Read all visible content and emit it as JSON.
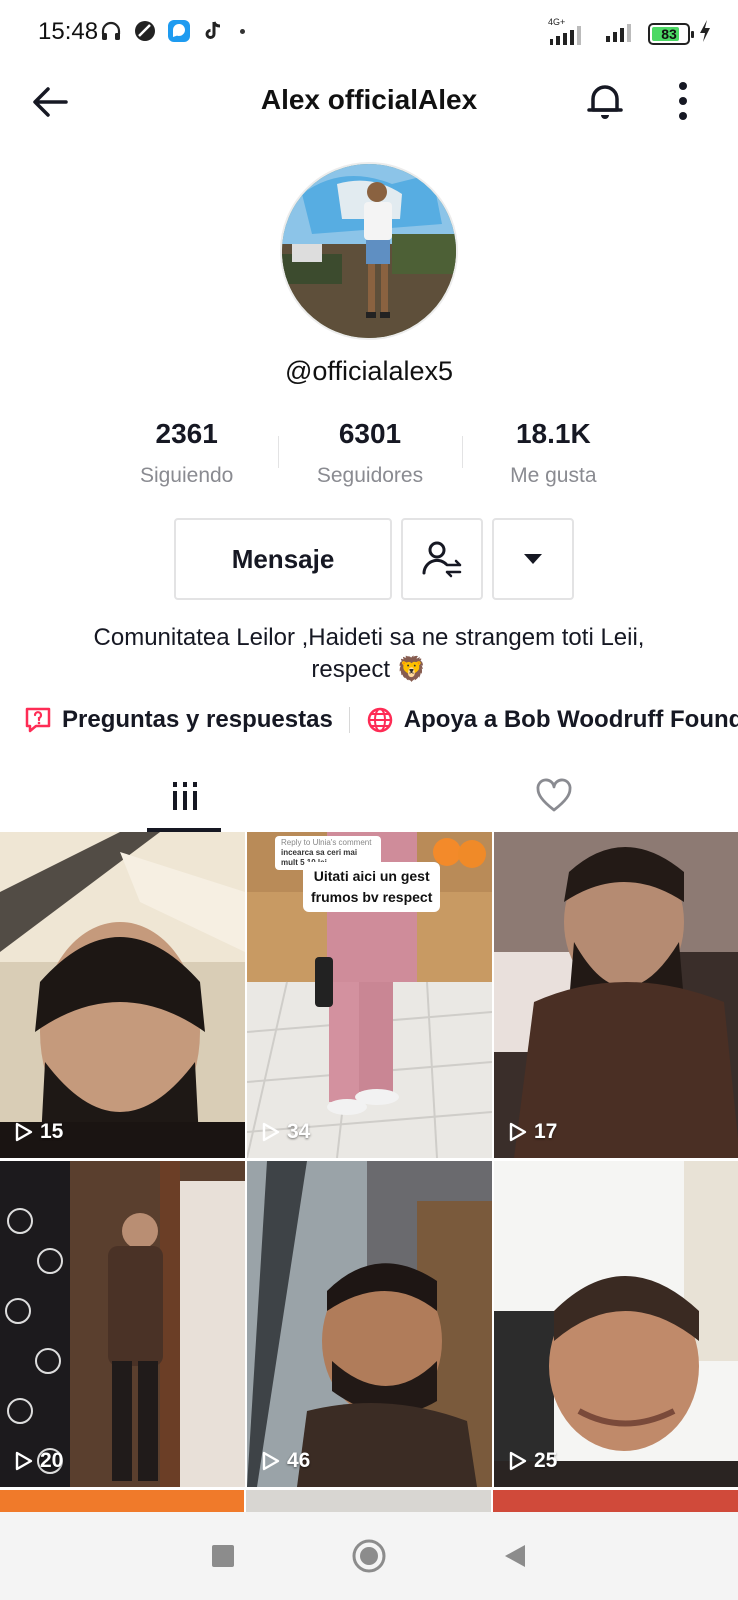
{
  "status_bar": {
    "time": "15:48",
    "network_label": "4G+",
    "battery_level": "83",
    "icons": [
      "headphones-icon",
      "app-icon",
      "messenger-icon",
      "tiktok-icon",
      "signal-icon",
      "wifi-signal-icon",
      "battery-icon",
      "charging-icon"
    ]
  },
  "header": {
    "title": "Alex officialAlex",
    "icons": [
      "back-arrow-icon",
      "bell-icon",
      "more-vertical-icon"
    ]
  },
  "profile": {
    "username": "@officialalex5",
    "stats": [
      {
        "value": "2361",
        "label": "Siguiendo"
      },
      {
        "value": "6301",
        "label": "Seguidores"
      },
      {
        "value": "18.1K",
        "label": "Me gusta"
      }
    ],
    "message_button": "Mensaje",
    "bio_line1": "Comunitatea Leilor ,Haideti sa ne strangem toti Leii,",
    "bio_line2": "respect 🦁",
    "links": [
      {
        "label": "Preguntas y respuestas",
        "icon": "question-box-icon"
      },
      {
        "label": "Apoya a Bob Woodruff Found",
        "icon": "globe-heart-icon"
      }
    ]
  },
  "tabs": [
    {
      "name": "videos",
      "icon": "grid-bars-icon",
      "active": true
    },
    {
      "name": "liked",
      "icon": "heart-outline-icon",
      "active": false
    }
  ],
  "videos": [
    {
      "views": "15"
    },
    {
      "views": "34",
      "reply_label": "Reply to Ulnia's comment",
      "reply_text": "incearca sa ceri mai mult 5 10 lei",
      "caption_line1": "Uitati aici un gest",
      "caption_line2": "frumos bv respect"
    },
    {
      "views": "17"
    },
    {
      "views": "20"
    },
    {
      "views": "46"
    },
    {
      "views": "25"
    }
  ],
  "colors": {
    "text_primary": "#161823",
    "text_secondary": "#8a8b91",
    "border": "#e3e3e4",
    "accent_red": "#fe2c55"
  }
}
